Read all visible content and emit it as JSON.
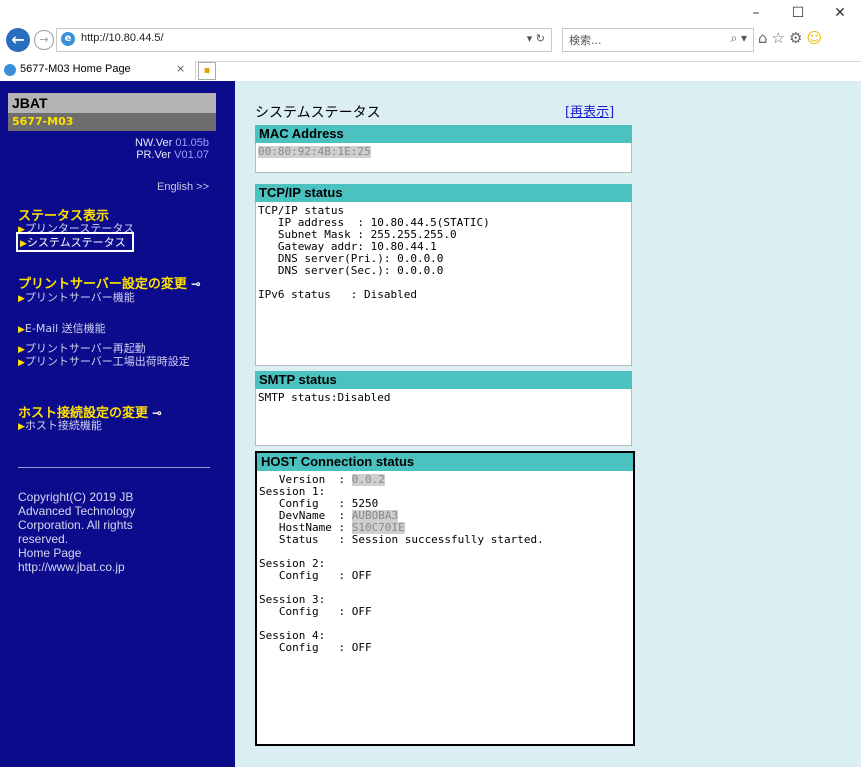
{
  "browser": {
    "url": "http://10.80.44.5/",
    "search_placeholder": "検索...",
    "tab_title": "5677-M03 Home Page",
    "window_minimize": "–",
    "window_maximize": "☐",
    "window_close": "✕"
  },
  "sidebar": {
    "brand": "JBAT",
    "model": "5677-M03",
    "nw_ver_label": "NW.Ver",
    "nw_ver_value": "01.05b",
    "pr_ver_label": "PR.Ver",
    "pr_ver_value": "V01.07",
    "english_link": "English >>",
    "status_heading": "ステータス表示",
    "status_links": [
      "プリンターステータス",
      "システムステータス"
    ],
    "print_server_heading": "プリントサーバー設定の変更",
    "print_server_link": "プリントサーバー機能",
    "email_link": "E-Mail 送信機能",
    "restart_link": "プリントサーバー再起動",
    "factory_link": "プリントサーバー工場出荷時設定",
    "host_heading": "ホスト接続設定の変更",
    "host_link": "ホスト接続機能",
    "copyright_lines": [
      "Copyright(C) 2019 JB",
      "Advanced Technology",
      "Corporation. All rights",
      "reserved.",
      "Home Page",
      "http://www.jbat.co.jp"
    ]
  },
  "main": {
    "title": "システムステータス",
    "refresh_link": "[再表示]",
    "mac": {
      "header": "MAC Address",
      "value": "00:80:92:4B:1E:25"
    },
    "tcpip": {
      "header": "TCP/IP status",
      "body": "TCP/IP status\n   IP address  : 10.80.44.5(STATIC)\n   Subnet Mask : 255.255.255.0\n   Gateway addr: 10.80.44.1\n   DNS server(Pri.): 0.0.0.0\n   DNS server(Sec.): 0.0.0.0\n\nIPv6 status   : Disabled"
    },
    "smtp": {
      "header": "SMTP status",
      "body": "SMTP status:Disabled"
    },
    "host": {
      "header": "HOST Connection status",
      "version_label": "   Version  : ",
      "version_value": "0.0.2",
      "session1_a": "\nSession 1:\n   Config   : 5250\n   DevName  : ",
      "devname": "AUBOBA3",
      "hostname_label": "\n   HostName : ",
      "hostname": "S10C70IE",
      "session1_b": "\n   Status   : Session successfully started.\n\nSession 2:\n   Config   : OFF\n\nSession 3:\n   Config   : OFF\n\nSession 4:\n   Config   : OFF"
    }
  }
}
